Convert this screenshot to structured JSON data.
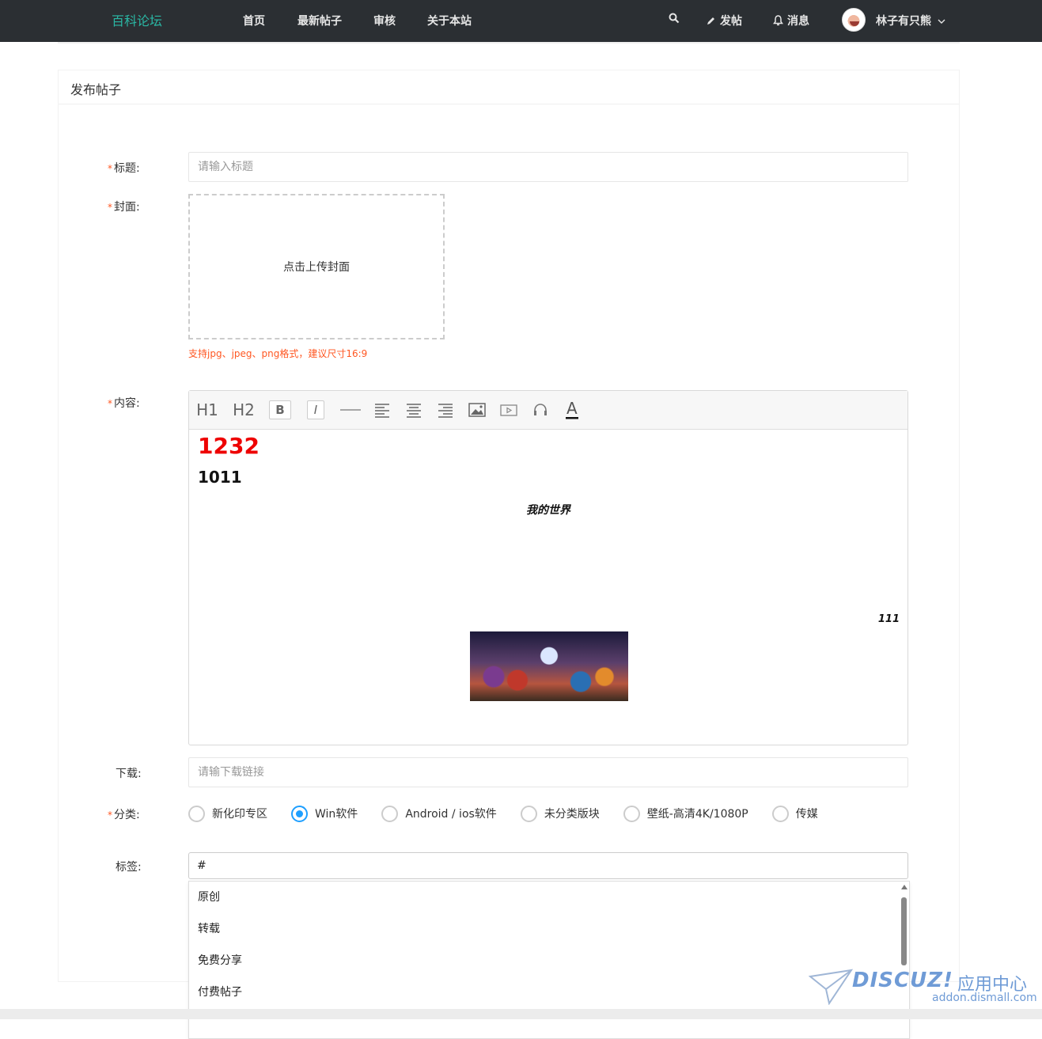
{
  "header": {
    "brand": "百科论坛",
    "nav": [
      "首页",
      "最新帖子",
      "审核",
      "关于本站"
    ],
    "post_label": "发帖",
    "messages_label": "消息",
    "username": "林子有只熊",
    "brand_color": "#2ab8a5",
    "icons": [
      "search-icon",
      "pencil-icon",
      "bell-icon",
      "chevron-down-icon"
    ]
  },
  "panel": {
    "title": "发布帖子"
  },
  "form": {
    "title_label": "标题:",
    "title_placeholder": "请输入标题",
    "cover_label": "封面:",
    "cover_prompt": "点击上传封面",
    "cover_hint": "支持jpg、jpeg、png格式，建议尺寸16:9",
    "content_label": "内容:",
    "download_label": "下载:",
    "download_placeholder": "请输下载链接",
    "category_label": "分类:",
    "tags_label": "标签:",
    "required_mark": "*"
  },
  "editor": {
    "toolbar": [
      "H1",
      "H2",
      "B",
      "I",
      "—",
      "align-left-icon",
      "align-center-icon",
      "align-right-icon",
      "image-icon",
      "video-icon",
      "audio-icon",
      "text-color-icon"
    ],
    "content": {
      "heading1": "1232",
      "heading1_color": "#e00000",
      "heading2": "1011",
      "centered_text": "我的世界",
      "right_text": "111"
    }
  },
  "categories": {
    "options": [
      "新化印专区",
      "Win软件",
      "Android / ios软件",
      "未分类版块",
      "壁纸-高清4K/1080P",
      "传媒"
    ],
    "selected": "Win软件",
    "accent": "#1e9fff"
  },
  "tags": {
    "value": "#",
    "suggestions": [
      "原创",
      "转载",
      "免费分享",
      "付费帖子"
    ]
  },
  "watermark": {
    "logo": "DISCUZ!",
    "cn": "应用中心",
    "url": "addon.dismall.com"
  }
}
